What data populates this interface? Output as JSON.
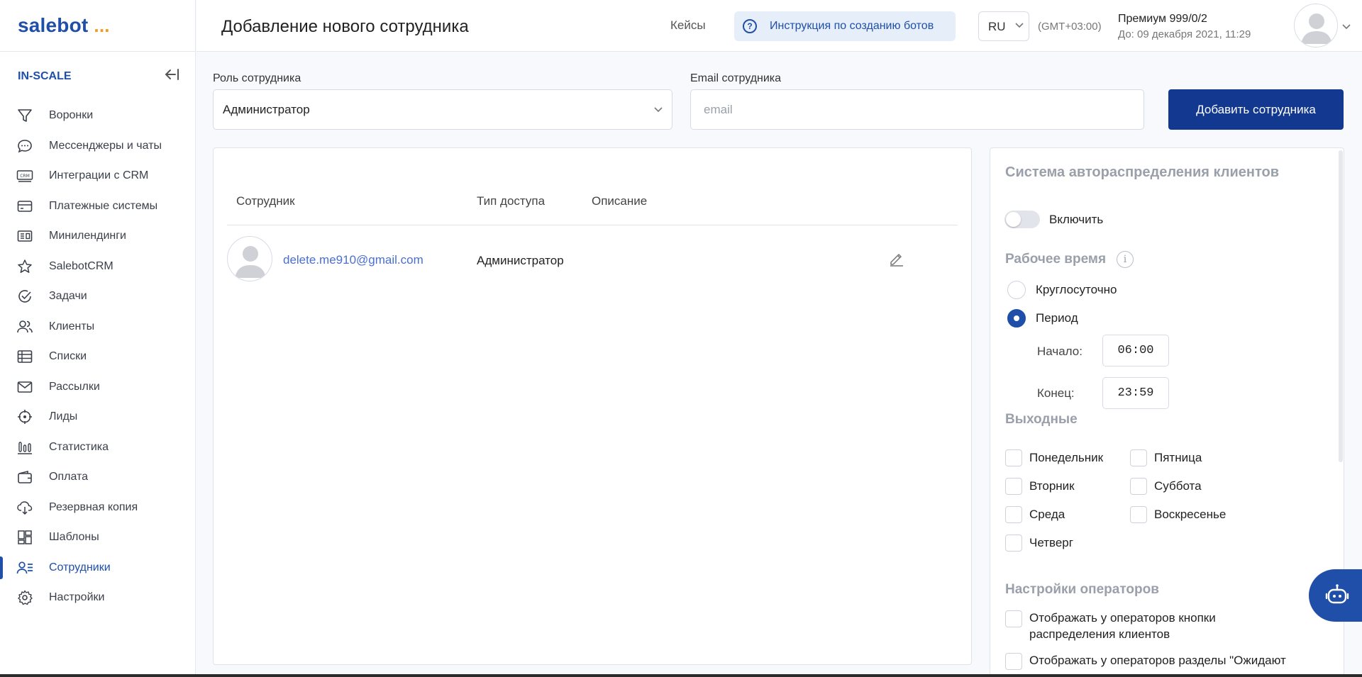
{
  "app": {
    "logo_text": "salebot",
    "logo_dots": "...",
    "org_name": "IN-SCALE",
    "collapse_icon": "collapse-left-icon"
  },
  "sidebar": {
    "items": [
      {
        "label": "Воронки",
        "icon": "funnel-icon"
      },
      {
        "label": "Мессенджеры и чаты",
        "icon": "chat-icon"
      },
      {
        "label": "Интеграции с CRM",
        "icon": "crm-icon"
      },
      {
        "label": "Платежные системы",
        "icon": "card-icon"
      },
      {
        "label": "Минилендинги",
        "icon": "landing-icon"
      },
      {
        "label": "SalebotCRM",
        "icon": "star-icon"
      },
      {
        "label": "Задачи",
        "icon": "check-circle-icon"
      },
      {
        "label": "Клиенты",
        "icon": "users-icon"
      },
      {
        "label": "Списки",
        "icon": "list-table-icon"
      },
      {
        "label": "Рассылки",
        "icon": "mail-icon"
      },
      {
        "label": "Лиды",
        "icon": "target-icon"
      },
      {
        "label": "Статистика",
        "icon": "bar-chart-icon"
      },
      {
        "label": "Оплата",
        "icon": "wallet-icon"
      },
      {
        "label": "Резервная копия",
        "icon": "cloud-download-icon"
      },
      {
        "label": "Шаблоны",
        "icon": "templates-icon"
      },
      {
        "label": "Сотрудники",
        "icon": "employees-icon",
        "active": true
      },
      {
        "label": "Настройки",
        "icon": "gear-icon"
      }
    ]
  },
  "header": {
    "title": "Добавление нового сотрудника",
    "cases_link": "Кейсы",
    "help_button": "Инструкция по созданию ботов",
    "language": "RU",
    "timezone": "(GMT+03:00)",
    "plan": "Премиум 999/0/2",
    "plan_until": "До: 09 декабря 2021, 11:29"
  },
  "form": {
    "role_label": "Роль сотрудника",
    "role_value": "Администратор",
    "email_label": "Email сотрудника",
    "email_placeholder": "email",
    "email_value": "",
    "add_button": "Добавить сотрудника"
  },
  "table": {
    "columns": [
      "Сотрудник",
      "Тип доступа",
      "Описание"
    ],
    "rows": [
      {
        "email": "delete.me910@gmail.com",
        "access": "Администратор",
        "description": ""
      }
    ]
  },
  "distribution": {
    "title": "Система автораспределения клиентов",
    "toggle_label": "Включить",
    "toggle_on": false,
    "work_time_title": "Рабочее время",
    "options": [
      "Круглосуточно",
      "Период"
    ],
    "selected_option": "Период",
    "start_label": "Начало:",
    "start_value": "06:00",
    "end_label": "Конец:",
    "end_value": "23:59",
    "weekends_title": "Выходные",
    "days_left": [
      "Понедельник",
      "Вторник",
      "Среда",
      "Четверг"
    ],
    "days_right": [
      "Пятница",
      "Суббота",
      "Воскресенье"
    ],
    "operators_title": "Настройки операторов",
    "operator_opt1": "Отображать у операторов кнопки распределения клиентов",
    "operator_opt2": "Отображать у операторов разделы \"Ожидают"
  },
  "colors": {
    "primary": "#1f4fa8",
    "button": "#12388f",
    "accent_dots": "#f39a1e"
  }
}
